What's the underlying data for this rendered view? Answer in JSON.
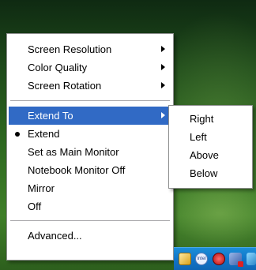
{
  "menu": {
    "items": [
      {
        "label": "Screen Resolution",
        "has_submenu": true
      },
      {
        "label": "Color Quality",
        "has_submenu": true
      },
      {
        "label": "Screen Rotation",
        "has_submenu": true
      },
      {
        "label": "Extend To",
        "has_submenu": true,
        "highlighted": true
      },
      {
        "label": "Extend",
        "checked": true
      },
      {
        "label": "Set as Main Monitor"
      },
      {
        "label": "Notebook Monitor Off"
      },
      {
        "label": "Mirror"
      },
      {
        "label": "Off"
      },
      {
        "label": "Advanced..."
      }
    ]
  },
  "submenu": {
    "items": [
      "Right",
      "Left",
      "Above",
      "Below"
    ]
  },
  "tray": {
    "icons": [
      "folder-icon",
      "network-icon",
      "security-shield-icon",
      "monitor-icon",
      "display-icon"
    ],
    "ic2_text": "Intel"
  },
  "colors": {
    "highlight": "#316ac5",
    "taskbar": "#1175c9"
  }
}
